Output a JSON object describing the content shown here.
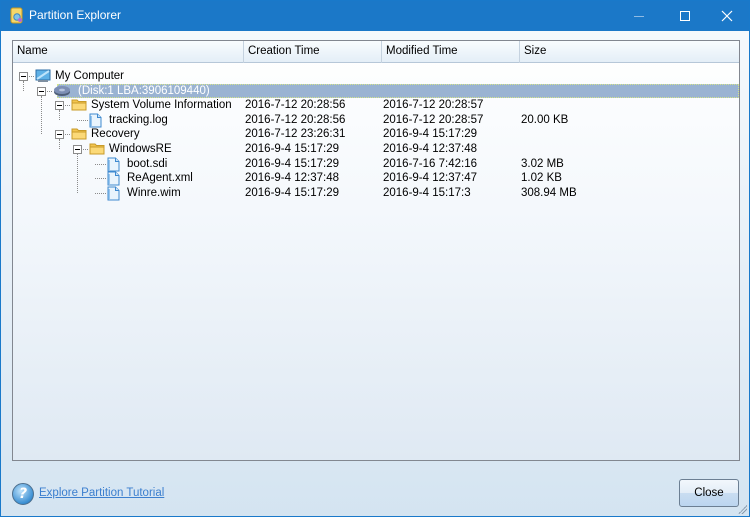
{
  "window": {
    "title": "Partition Explorer",
    "icon": "partition-app-icon",
    "controls": [
      "minimize",
      "maximize",
      "close"
    ]
  },
  "tree": {
    "columns": [
      {
        "label": "Name"
      },
      {
        "label": "Creation Time"
      },
      {
        "label": "Modified Time"
      },
      {
        "label": "Size"
      }
    ],
    "rows": [
      {
        "name": "My Computer",
        "icon": "computer-icon",
        "level": 0,
        "expanded": true,
        "created": "",
        "modified": "",
        "size": "",
        "selected": false
      },
      {
        "name": "(Disk:1 LBA:3906109440)",
        "icon": "disk-icon",
        "level": 1,
        "expanded": true,
        "created": "",
        "modified": "",
        "size": "",
        "selected": true
      },
      {
        "name": "System Volume Information",
        "icon": "folder-icon",
        "level": 2,
        "expanded": true,
        "created": "2016-7-12 20:28:56",
        "modified": "2016-7-12 20:28:57",
        "size": "",
        "selected": false
      },
      {
        "name": "tracking.log",
        "icon": "file-icon",
        "level": 3,
        "expanded": null,
        "created": "2016-7-12 20:28:56",
        "modified": "2016-7-12 20:28:57",
        "size": "20.00 KB",
        "selected": false
      },
      {
        "name": "Recovery",
        "icon": "folder-icon",
        "level": 2,
        "expanded": true,
        "created": "2016-7-12 23:26:31",
        "modified": "2016-9-4 15:17:29",
        "size": "",
        "selected": false
      },
      {
        "name": "WindowsRE",
        "icon": "folder-icon",
        "level": 3,
        "expanded": true,
        "created": "2016-9-4 15:17:29",
        "modified": "2016-9-4 12:37:48",
        "size": "",
        "selected": false
      },
      {
        "name": "boot.sdi",
        "icon": "file-icon",
        "level": 4,
        "expanded": null,
        "created": "2016-9-4 15:17:29",
        "modified": "2016-7-16 7:42:16",
        "size": "3.02 MB",
        "selected": false
      },
      {
        "name": "ReAgent.xml",
        "icon": "file-icon",
        "level": 4,
        "expanded": null,
        "created": "2016-9-4 12:37:48",
        "modified": "2016-9-4 12:37:47",
        "size": "1.02 KB",
        "selected": false
      },
      {
        "name": "Winre.wim",
        "icon": "file-icon",
        "level": 4,
        "expanded": null,
        "created": "2016-9-4 15:17:29",
        "modified": "2016-9-4 15:17:3",
        "size": "308.94 MB",
        "selected": false
      }
    ]
  },
  "footer": {
    "help_icon": "help-icon",
    "tutorial_link": "Explore Partition Tutorial",
    "close_label": "Close"
  },
  "colors": {
    "titlebar": "#1b78c8",
    "selection": "#9ab3d2",
    "link": "#3b7fcf"
  }
}
